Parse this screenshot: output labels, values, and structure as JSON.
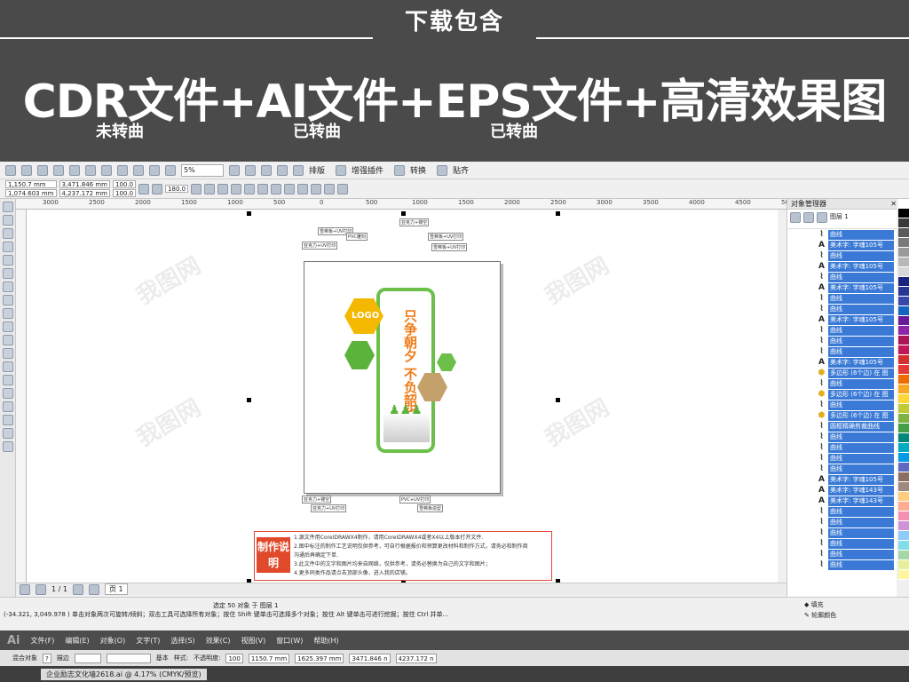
{
  "banner": {
    "download_title": "下载包含",
    "headline": "CDR文件+AI文件+EPS文件+高清效果图",
    "sub1": "未转曲",
    "sub2": "已转曲",
    "sub3": "已转曲"
  },
  "toolbar": {
    "zoom": "5%",
    "btn_layout": "排版",
    "btn_plugin": "增强插件",
    "btn_convert": "转换",
    "btn_paste": "贴齐"
  },
  "props": {
    "x": "1,150.7 mm",
    "y": "1,074.603 mm",
    "w": "3,471.846 mm",
    "h": "4,237.172 mm",
    "sx": "100.0",
    "sy": "100.0",
    "angle": "180.0"
  },
  "ruler": {
    "ticks": [
      "3000",
      "2500",
      "2000",
      "1500",
      "1000",
      "500",
      "0",
      "500",
      "1000",
      "1500",
      "2000",
      "2500",
      "3000",
      "3500",
      "4000",
      "4500",
      "5000"
    ]
  },
  "design": {
    "logo_text": "LOGO",
    "slogan": "只争朝夕 不负韶华",
    "instruction_badge": "制作说明",
    "instructions": [
      "1.源文件用CoreIDRAWX4制作，请用CoreIDRAWX4或者X4以上版本打开文件.",
      "2.图中标注的制作工艺说明仅供参考，可自行根据报价和预算更改材料和制作方式，请务必和制作商",
      "   沟通后再确定下单.",
      "3.此文件中的文字和图片均来自网络，仅供参考，请务必替换为自己的文字和图片；",
      "4.更多同类作品请点击顶部头像，进入我的店铺。"
    ],
    "callouts": [
      "雪弗板+UV打印",
      "亚克力+镂空",
      "PVC雕刻",
      "雪弗板+UV打印",
      "亚克力+UV打印",
      "雪弗板+UV打印",
      "亚克力+镂空",
      "PVC+UV打印",
      "亚克力+UV打印",
      "雪弗板造型"
    ]
  },
  "object_manager": {
    "title": "对象管理器",
    "page_label": "图层 1",
    "items": [
      {
        "icon": "curve",
        "text": "曲线"
      },
      {
        "icon": "A",
        "text": "美术字: 字魂105号"
      },
      {
        "icon": "curve",
        "text": "曲线"
      },
      {
        "icon": "A",
        "text": "美术字: 字魂105号"
      },
      {
        "icon": "curve",
        "text": "曲线"
      },
      {
        "icon": "A",
        "text": "美术字: 字魂105号"
      },
      {
        "icon": "curve",
        "text": "曲线"
      },
      {
        "icon": "curve",
        "text": "曲线"
      },
      {
        "icon": "A",
        "text": "美术字: 字魂105号"
      },
      {
        "icon": "curve",
        "text": "曲线"
      },
      {
        "icon": "curve",
        "text": "曲线"
      },
      {
        "icon": "curve",
        "text": "曲线"
      },
      {
        "icon": "A",
        "text": "美术字: 字魂105号"
      },
      {
        "icon": "hex",
        "text": "多边形 (6个边) 在 图"
      },
      {
        "icon": "curve",
        "text": "曲线"
      },
      {
        "icon": "hex",
        "text": "多边形 (6个边) 在 图"
      },
      {
        "icon": "curve",
        "text": "曲线"
      },
      {
        "icon": "hex",
        "text": "多边形 (6个边) 在 图"
      },
      {
        "icon": "curve",
        "text": "圆框精确剪裁曲线"
      },
      {
        "icon": "curve",
        "text": "曲线"
      },
      {
        "icon": "curve",
        "text": "曲线"
      },
      {
        "icon": "curve",
        "text": "曲线"
      },
      {
        "icon": "curve",
        "text": "曲线"
      },
      {
        "icon": "A",
        "text": "美术字: 字魂105号"
      },
      {
        "icon": "A",
        "text": "美术字: 字魂143号"
      },
      {
        "icon": "A",
        "text": "美术字: 字魂143号"
      },
      {
        "icon": "curve",
        "text": "曲线"
      },
      {
        "icon": "curve",
        "text": "曲线"
      },
      {
        "icon": "curve",
        "text": "曲线"
      },
      {
        "icon": "curve",
        "text": "曲线"
      },
      {
        "icon": "curve",
        "text": "曲线"
      },
      {
        "icon": "curve",
        "text": "曲线"
      }
    ]
  },
  "pagebar": {
    "page_count": "1 / 1",
    "page_tab": "页 1"
  },
  "status": {
    "selection": "选定 50 对象 于 图层 1",
    "hint": "(-34.321, 3,049.978 ) 单击对象两次可旋转/倾斜；双击工具可选择所有对象；按住 Shift 键单击可选择多个对象；按住 Alt 键单击可进行挖掘；按住 Ctrl 并单...",
    "fill": "填充",
    "outline": "轮廓颜色"
  },
  "illustrator": {
    "logo": "Ai",
    "menus": [
      "文件(F)",
      "编辑(E)",
      "对象(O)",
      "文字(T)",
      "选择(S)",
      "效果(C)",
      "视图(V)",
      "窗口(W)",
      "帮助(H)"
    ],
    "ctrl_label": "混合对象",
    "stroke_label": "描边",
    "basic": "基本",
    "style": "样式:",
    "opacity": "不透明度:",
    "opacity_val": "100",
    "x": "1150.7 mm",
    "y": "1625.397 mm",
    "w": "3471.846 n",
    "h": "4237.172 n",
    "doc_tab": "企业励志文化墙2618.ai @ 4.17% (CMYK/预览)"
  },
  "palette": [
    "#ffffff",
    "#000000",
    "#3a3a3a",
    "#5a5a5a",
    "#7a7a7a",
    "#9a9a9a",
    "#b8b8b8",
    "#d8d8d8",
    "#1a237e",
    "#283593",
    "#3949ab",
    "#1565c0",
    "#6a1b9a",
    "#8e24aa",
    "#ad1457",
    "#c2185b",
    "#d32f2f",
    "#e53935",
    "#ef6c00",
    "#f9a825",
    "#fdd835",
    "#c0ca33",
    "#7cb342",
    "#43a047",
    "#00897b",
    "#00acc1",
    "#039be5",
    "#5c6bc0",
    "#8d6e63",
    "#a1887f",
    "#ffcc80",
    "#ffab91",
    "#f48fb1",
    "#ce93d8",
    "#90caf9",
    "#80deea",
    "#a5d6a7",
    "#e6ee9c",
    "#fff59d"
  ]
}
